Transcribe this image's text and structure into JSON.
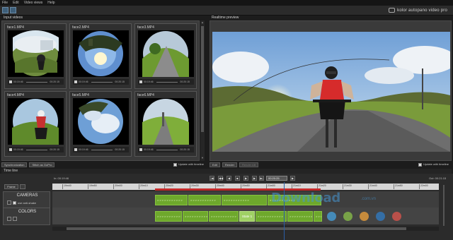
{
  "menu": [
    "File",
    "Edit",
    "Video views",
    "Help"
  ],
  "app": {
    "brand": "kolor autopano video pro"
  },
  "input_panel": {
    "title": "Input videos",
    "tiles": [
      {
        "label": "face1.MP4",
        "time_start": "00:19:46",
        "time_end": "00:20:15"
      },
      {
        "label": "face2.MP4",
        "time_start": "00:19:46",
        "time_end": "00:20:15"
      },
      {
        "label": "face3.MP4",
        "time_start": "00:19:46",
        "time_end": "00:20:15"
      },
      {
        "label": "face4.MP4",
        "time_start": "00:19:46",
        "time_end": "00:20:15"
      },
      {
        "label": "face5.MP4",
        "time_start": "00:19:46",
        "time_end": "00:20:15"
      },
      {
        "label": "face6.MP4",
        "time_start": "00:19:46",
        "time_end": "00:20:15"
      }
    ],
    "footer": {
      "synchronization": "Synchronization",
      "stitch": "Stitch as GoPro",
      "update_with_timeline": "Update with timeline"
    }
  },
  "preview_panel": {
    "title": "Realtime preview",
    "footer": {
      "edit": "Edit",
      "render": "Render",
      "render_ab": "Render AB",
      "update_with_timeline": "Update with timeline"
    }
  },
  "timeline": {
    "title": "Time line",
    "in_time": "In: 00:19:46",
    "out_time": "Out: 00:21:15",
    "current_time": "00:20:25",
    "frame_label": "Frame",
    "ruler": [
      "19m40",
      "19m50",
      "20m00",
      "20m10",
      "20m20",
      "20m30",
      "20m40",
      "20m50",
      "21m00",
      "21m10",
      "21m20",
      "21m30",
      "21m40",
      "21m50",
      "22m00"
    ],
    "tracks": [
      {
        "name": "CAMERAS",
        "option": "use anti-shake",
        "clips": [
          ">>>>>>>>>>>",
          ">>>>>>>>>>>",
          ">>>>>>>>>>>",
          ">>>>>>>>>>>"
        ]
      },
      {
        "name": "COLORS",
        "state_label": "State 1",
        "clips": [
          ">>>>>>>>>>>",
          ">>>>>>>>>>>",
          ">>>>>>>>>>>",
          ">>>>>>>>>>>",
          ">>>>>>>>>>>",
          ">>>>>>>>>>>"
        ]
      }
    ]
  },
  "watermark": {
    "text": "Download",
    "sub": ".com.vn"
  },
  "colors": {
    "accent": "#6ea82c",
    "timeline_marker": "#c42a2a",
    "playhead": "#2b5ea6"
  }
}
